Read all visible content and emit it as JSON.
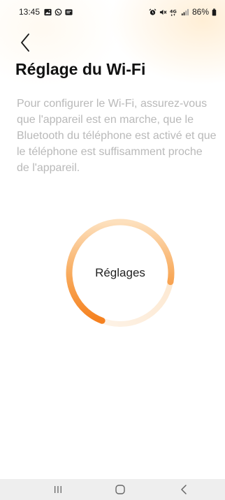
{
  "status_bar": {
    "time": "13:45",
    "network": "4G",
    "battery": "86%",
    "left_icons": [
      "gallery-icon",
      "whatsapp-icon",
      "message-icon"
    ],
    "right_icons": [
      "alarm-icon",
      "mute-icon",
      "network-icon",
      "signal-icon",
      "battery-icon"
    ]
  },
  "header": {
    "title": "Réglage du Wi-Fi"
  },
  "main": {
    "description": "Pour configurer le Wi-Fi, assurez-vous que l'appareil est en marche, que le Bluetooth du téléphone est activé et que le téléphone est suffisamment proche de l'appareil.",
    "progress": {
      "label": "Réglages",
      "fraction": 0.72
    }
  },
  "nav_bar": {
    "buttons": [
      "recent-apps-icon",
      "home-icon",
      "back-icon"
    ]
  },
  "colors": {
    "accent": "#f5811f",
    "accent_light": "#fde2c4",
    "description_text": "#b9b9b9",
    "title_text": "#111111",
    "nav_background": "#eeeeee"
  }
}
